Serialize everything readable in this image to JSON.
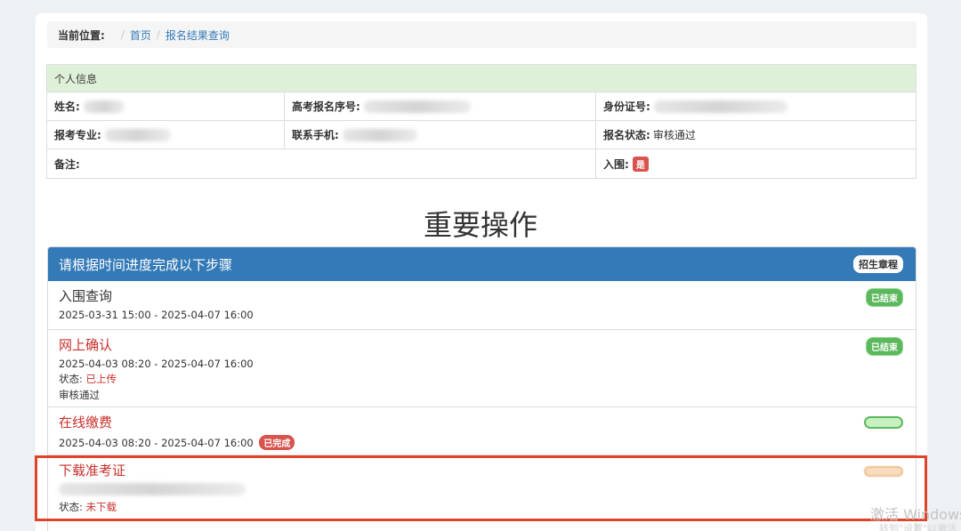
{
  "breadcrumb": {
    "label": "当前位置:",
    "home": "首页",
    "current": "报名结果查询"
  },
  "info": {
    "header": "个人信息",
    "name_label": "姓名:",
    "exam_no_label": "高考报名序号:",
    "id_label": "身份证号:",
    "major_label": "报考专业:",
    "phone_label": "联系手机:",
    "status_label": "报名状态:",
    "status_value": "审核通过",
    "remark_label": "备注:",
    "shortlist_label": "入围:",
    "shortlist_value": "是"
  },
  "section_title": "重要操作",
  "steps": {
    "header": "请根据时间进度完成以下步骤",
    "header_badge": "招生章程",
    "items": [
      {
        "title": "入围查询",
        "time": "2025-03-31 15:00 - 2025-04-07 16:00",
        "badge": "已结束"
      },
      {
        "title": "网上确认",
        "time": "2025-04-03 08:20 - 2025-04-07 16:00",
        "status_label": "状态:",
        "status_value": "已上传",
        "note": "审核通过",
        "badge": "已结束"
      },
      {
        "title": "在线缴费",
        "time": "2025-04-03 08:20 - 2025-04-07 16:00",
        "time_badge": "已完成"
      },
      {
        "title": "下载准考证",
        "status_label": "状态:",
        "status_value": "未下载"
      }
    ]
  },
  "watermark": {
    "line1": "激活 Windows",
    "line2": "转到\"设置\"以激活"
  },
  "colors": {
    "primary": "#337ab7",
    "success": "#5cb85c",
    "danger": "#d9534f",
    "info_header_bg": "#dff0d8",
    "highlight": "#e04428"
  }
}
